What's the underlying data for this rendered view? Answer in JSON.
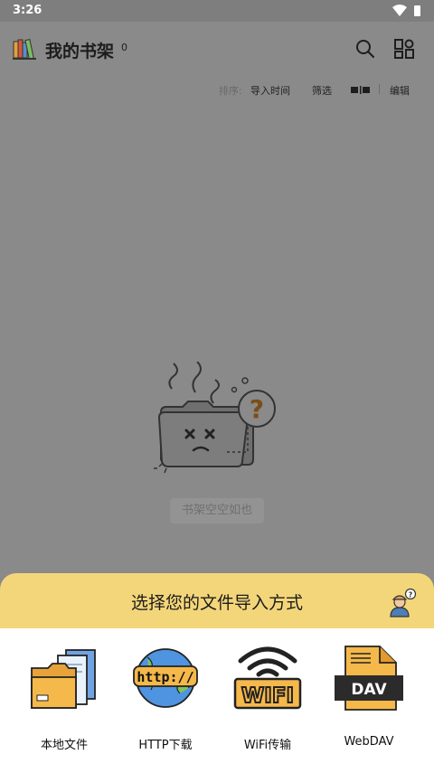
{
  "status": {
    "time": "3:26"
  },
  "header": {
    "title": "我的书架",
    "count": "0"
  },
  "sort": {
    "label": "排序:",
    "value": "导入时间",
    "filter": "筛选",
    "edit": "编辑"
  },
  "empty": {
    "text": "书架空空如也"
  },
  "sheet": {
    "title": "选择您的文件导入方式",
    "options": [
      {
        "label": "本地文件",
        "icon": "folder-icon"
      },
      {
        "label": "HTTP下载",
        "icon": "http-globe-icon",
        "badge": "http://"
      },
      {
        "label": "WiFi传输",
        "icon": "wifi-icon",
        "badge": "WIFI"
      },
      {
        "label": "WebDAV",
        "icon": "webdav-file-icon",
        "badge": "DAV"
      }
    ]
  },
  "colors": {
    "overlay": "#8a8a8a",
    "sheet_header": "#f4d67a",
    "accent": "#f2b84b"
  }
}
